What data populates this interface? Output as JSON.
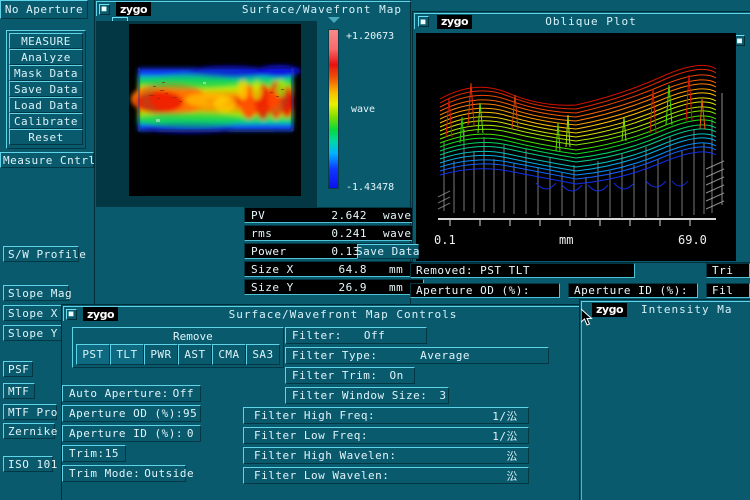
{
  "app": {
    "brand": "zygo"
  },
  "sidebar": {
    "aperture_status": "No Aperture",
    "menu": [
      "MEASURE",
      "Analyze",
      "Mask Data",
      "Save Data",
      "Load Data",
      "Calibrate",
      "Reset"
    ],
    "measure_cntrl": "Measure Cntrl",
    "items": [
      "S/W Profile",
      "Slope Mag",
      "Slope X",
      "Slope Y",
      "PSF",
      "MTF",
      "MTF Pro",
      "Zernike",
      "ISO 101"
    ]
  },
  "map_window": {
    "title": "Surface/Wavefront Map",
    "colorbar": {
      "max": "+1.20673",
      "min": "-1.43478",
      "unit": "wave"
    },
    "stats": [
      {
        "label": "PV",
        "value": "2.642",
        "unit": "wave"
      },
      {
        "label": "rms",
        "value": "0.241",
        "unit": "wave"
      },
      {
        "label": "Power",
        "value": "0.130",
        "unit": "wave"
      },
      {
        "label": "Size X",
        "value": "64.8",
        "unit": "mm"
      },
      {
        "label": "Size Y",
        "value": "26.9",
        "unit": "mm"
      }
    ],
    "save_data_label": "Save Data",
    "removed": "Removed: PST TLT",
    "aperture_od_label": "Aperture OD (%):",
    "aperture_id_label": "Aperture ID (%):",
    "right_trim_label": "Tri",
    "right_fil_label": "Fil"
  },
  "oblique_window": {
    "title": "Oblique Plot",
    "axis_min": "0.1",
    "axis_unit": "mm",
    "axis_max": "69.0"
  },
  "controls_window": {
    "title": "Surface/Wavefront Map Controls",
    "remove_group_label": "Remove",
    "remove_buttons": [
      "PST",
      "TLT",
      "PWR",
      "AST",
      "CMA",
      "SA3"
    ],
    "remove_active": [
      "PST",
      "TLT"
    ],
    "left_fields": [
      {
        "label": "Auto Aperture:",
        "value": "Off"
      },
      {
        "label": "Aperture OD (%):",
        "value": "95"
      },
      {
        "label": "Aperture ID (%):",
        "value": "0"
      },
      {
        "label": "Trim:",
        "value": "15"
      },
      {
        "label": "Trim Mode:",
        "value": "Outside"
      }
    ],
    "filter_fields": [
      {
        "label": "Filter:",
        "value": "Off"
      },
      {
        "label": "Filter Type:",
        "value": "Average"
      },
      {
        "label": "Filter Trim:",
        "value": "On"
      },
      {
        "label": "Filter Window Size:",
        "value": "3"
      }
    ],
    "freq_fields": [
      {
        "label": "Filter High Freq:",
        "value": "1/㳂"
      },
      {
        "label": "Filter Low  Freq:",
        "value": "1/㳂"
      },
      {
        "label": "Filter High Wavelen:",
        "value": "㳂"
      },
      {
        "label": "Filter Low  Wavelen:",
        "value": "㳂"
      }
    ]
  },
  "intensity_window": {
    "title": "Intensity Ma"
  },
  "chart_data": {
    "type": "heatmap",
    "title": "Surface/Wavefront Map",
    "colorbar_label": "wave",
    "zmax": 1.20673,
    "zmin": -1.43478,
    "pv": 2.642,
    "rms": 0.241,
    "power": 0.13,
    "size_x_mm": 64.8,
    "size_y_mm": 26.9,
    "oblique": {
      "type": "surface",
      "xlabel": "mm",
      "xlim": [
        0.1,
        69.0
      ]
    }
  }
}
